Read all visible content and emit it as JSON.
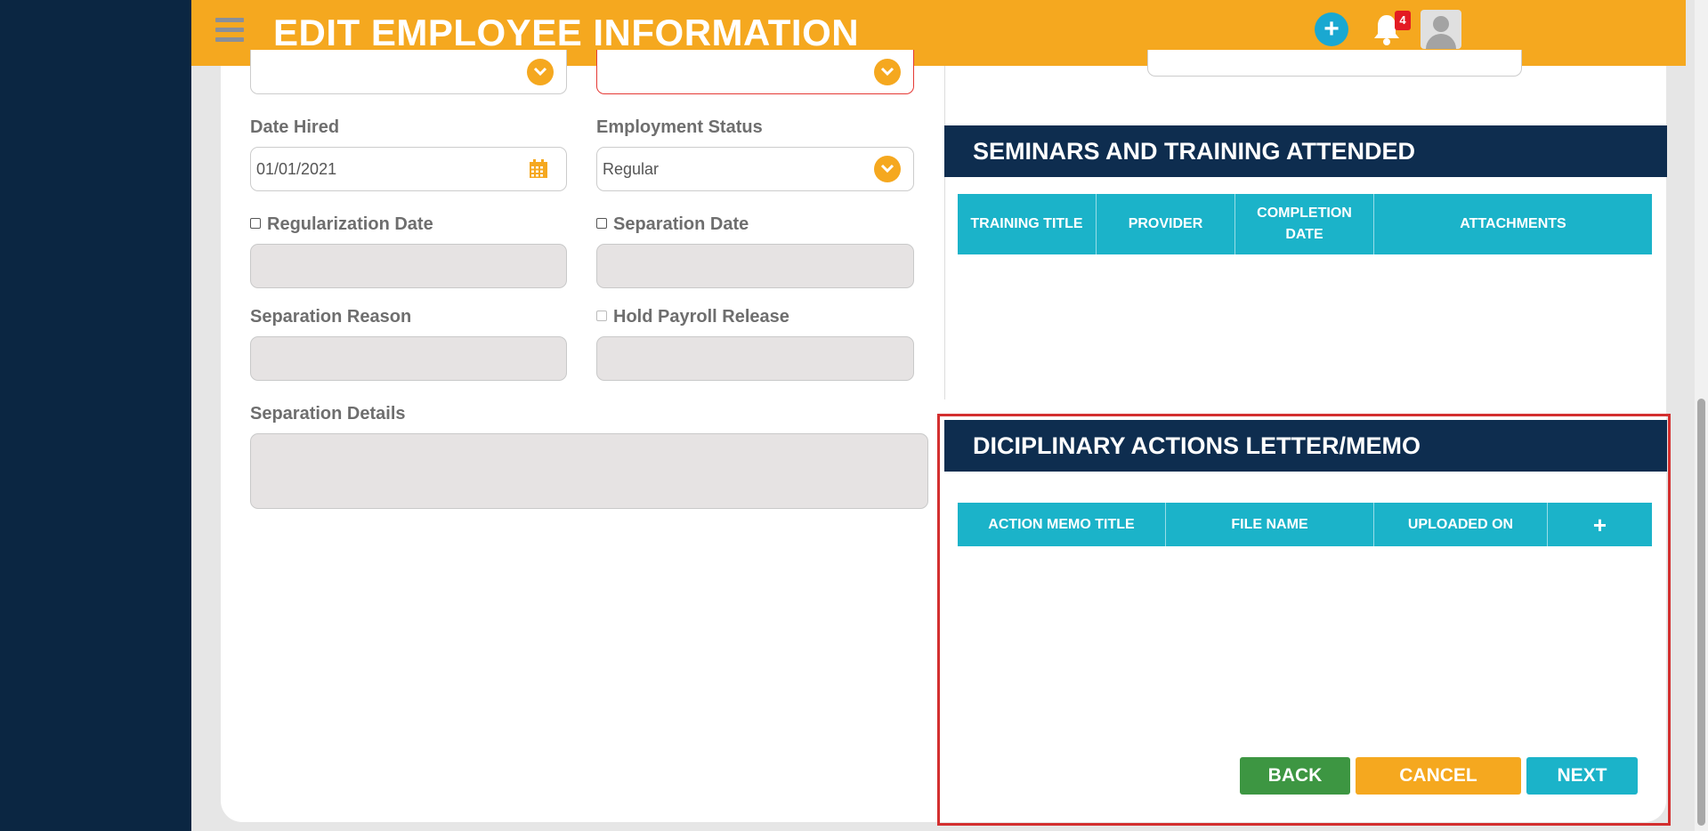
{
  "header": {
    "title": "EDIT EMPLOYEE INFORMATION",
    "notification_count": "4",
    "add_icon_glyph": "+"
  },
  "form": {
    "top_left_select_value": "",
    "top_right_select_value": "",
    "date_hired": {
      "label": "Date Hired",
      "value": "01/01/2021"
    },
    "employment_status": {
      "label": "Employment Status",
      "value": "Regular"
    },
    "regularization_date": {
      "label": "Regularization Date",
      "value": ""
    },
    "separation_date": {
      "label": "Separation Date",
      "value": ""
    },
    "separation_reason": {
      "label": "Separation Reason",
      "value": ""
    },
    "hold_payroll_release": {
      "label": "Hold Payroll Release",
      "value": ""
    },
    "separation_details": {
      "label": "Separation Details",
      "value": ""
    }
  },
  "seminars": {
    "title": "SEMINARS AND TRAINING ATTENDED",
    "columns": [
      "TRAINING TITLE",
      "PROVIDER",
      "COMPLETION DATE",
      "ATTACHMENTS"
    ]
  },
  "disciplinary": {
    "title": "DICIPLINARY ACTIONS LETTER/MEMO",
    "columns": [
      "ACTION MEMO TITLE",
      "FILE NAME",
      "UPLOADED ON"
    ],
    "add_glyph": "+"
  },
  "buttons": {
    "back": "BACK",
    "cancel": "CANCEL",
    "next": "NEXT"
  },
  "colors": {
    "header": "#f5a81f",
    "sidebar": "#0b2642",
    "section_header": "#0e2d4f",
    "table_header": "#1bb3c9",
    "back": "#3d9642",
    "cancel": "#f5a81f",
    "next": "#1bb3c9",
    "highlight": "#d32f2f"
  }
}
